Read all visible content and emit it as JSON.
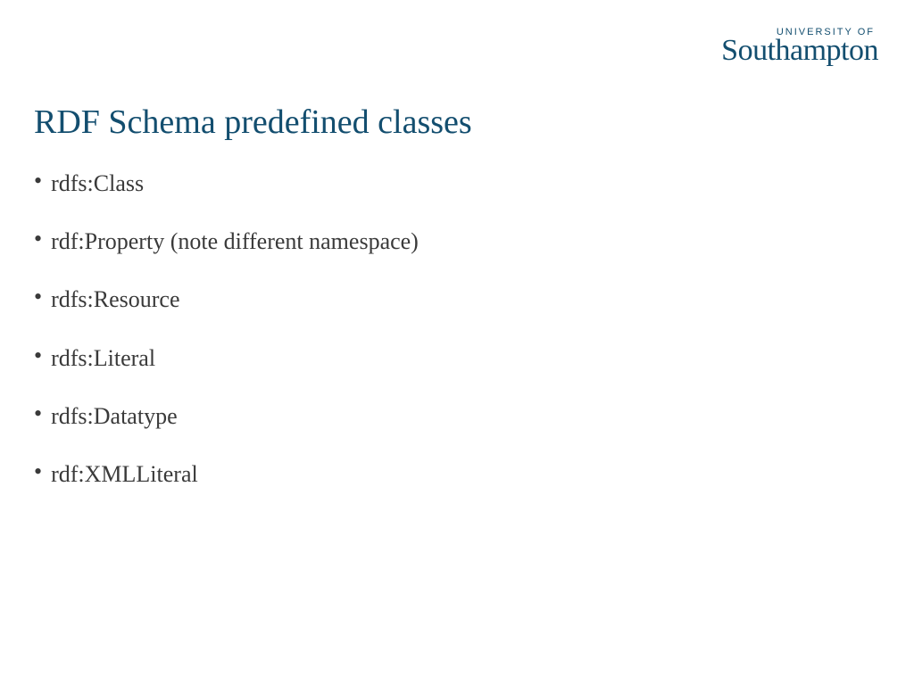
{
  "logo": {
    "top": "UNIVERSITY OF",
    "main": "Southampton"
  },
  "title": "RDF Schema predefined classes",
  "bullets": [
    "rdfs:Class",
    "rdf:Property (note different namespace)",
    "rdfs:Resource",
    "rdfs:Literal",
    "rdfs:Datatype",
    "rdf:XMLLiteral"
  ]
}
